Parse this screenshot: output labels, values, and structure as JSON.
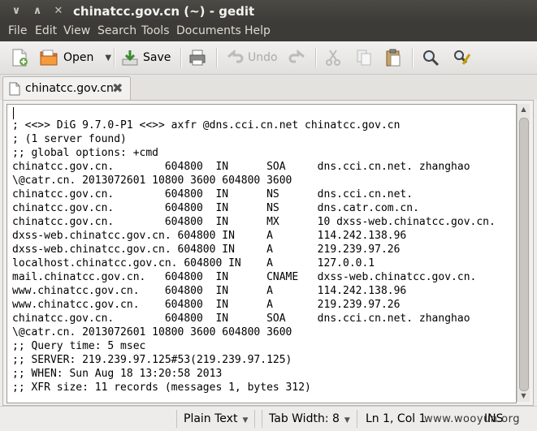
{
  "window": {
    "title": "chinatcc.gov.cn (~) - gedit",
    "controls": {
      "minimize": "∨",
      "maximize": "∧",
      "close": "✕"
    }
  },
  "menu": [
    "File",
    "Edit",
    "View",
    "Search",
    "Tools",
    "Documents",
    "Help"
  ],
  "toolbar": {
    "open_label": "Open",
    "save_label": "Save",
    "undo_label": "Undo"
  },
  "tabs": [
    {
      "label": "chinatcc.gov.cn",
      "close": "✖"
    }
  ],
  "editor": {
    "lines": [
      "",
      "; <<>> DiG 9.7.0-P1 <<>> axfr @dns.cci.cn.net chinatcc.gov.cn",
      "; (1 server found)",
      ";; global options: +cmd",
      "chinatcc.gov.cn.        604800  IN      SOA     dns.cci.cn.net. zhanghao",
      "\\@catr.cn. 2013072601 10800 3600 604800 3600",
      "chinatcc.gov.cn.        604800  IN      NS      dns.cci.cn.net.",
      "chinatcc.gov.cn.        604800  IN      NS      dns.catr.com.cn.",
      "chinatcc.gov.cn.        604800  IN      MX      10 dxss-web.chinatcc.gov.cn.",
      "dxss-web.chinatcc.gov.cn. 604800 IN     A       114.242.138.96",
      "dxss-web.chinatcc.gov.cn. 604800 IN     A       219.239.97.26",
      "localhost.chinatcc.gov.cn. 604800 IN    A       127.0.0.1",
      "mail.chinatcc.gov.cn.   604800  IN      CNAME   dxss-web.chinatcc.gov.cn.",
      "www.chinatcc.gov.cn.    604800  IN      A       114.242.138.96",
      "www.chinatcc.gov.cn.    604800  IN      A       219.239.97.26",
      "chinatcc.gov.cn.        604800  IN      SOA     dns.cci.cn.net. zhanghao",
      "\\@catr.cn. 2013072601 10800 3600 604800 3600",
      ";; Query time: 5 msec",
      ";; SERVER: 219.239.97.125#53(219.239.97.125)",
      ";; WHEN: Sun Aug 18 13:20:58 2013",
      ";; XFR size: 11 records (messages 1, bytes 312)"
    ]
  },
  "status": {
    "syntax": "Plain Text",
    "tab_width": "Tab Width: 8",
    "position": "Ln 1, Col 1",
    "mode": "INS"
  },
  "watermark": "www.wooyun.org"
}
